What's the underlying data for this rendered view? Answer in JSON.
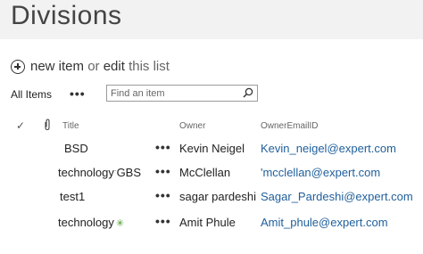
{
  "page": {
    "title": "Divisions"
  },
  "commands": {
    "new_item": "new item",
    "or": "or",
    "edit": "edit",
    "this_list": "this list"
  },
  "view": {
    "label": "All Items",
    "more": "•••",
    "search_placeholder": "Find an item"
  },
  "columns": {
    "title": "Title",
    "owner": "Owner",
    "email": "OwnerEmailID"
  },
  "rows": [
    {
      "title": "BSD",
      "title_sup": "",
      "badge": "",
      "more": "•••",
      "owner": "Kevin Neigel",
      "email": "Kevin_neigel@expert.com"
    },
    {
      "title": "technology",
      "title_sup": "·",
      "title_suffix": "GBS",
      "badge": "",
      "more": "•••",
      "owner": "McClellan",
      "email": "'mcclellan@expert.com"
    },
    {
      "title": "test1",
      "title_sup": "",
      "badge": "",
      "more": "•••",
      "owner": "sagar pardeshi",
      "email": "Sagar_Pardeshi@expert.com"
    },
    {
      "title": "technology",
      "title_sup": "",
      "badge": "✳",
      "more": "•••",
      "owner": "Amit Phule",
      "email": "Amit_phule@expert.com"
    }
  ],
  "icons": {
    "add": "plus-circle-icon",
    "search": "magnifier-icon",
    "select_all": "checkmark-icon",
    "attachment": "paperclip-icon",
    "new_item_badge": "new-star-icon"
  },
  "colors": {
    "link": "#1f5f9b",
    "title_bar": "#f2f2f2",
    "badge": "#4a9a2a"
  }
}
